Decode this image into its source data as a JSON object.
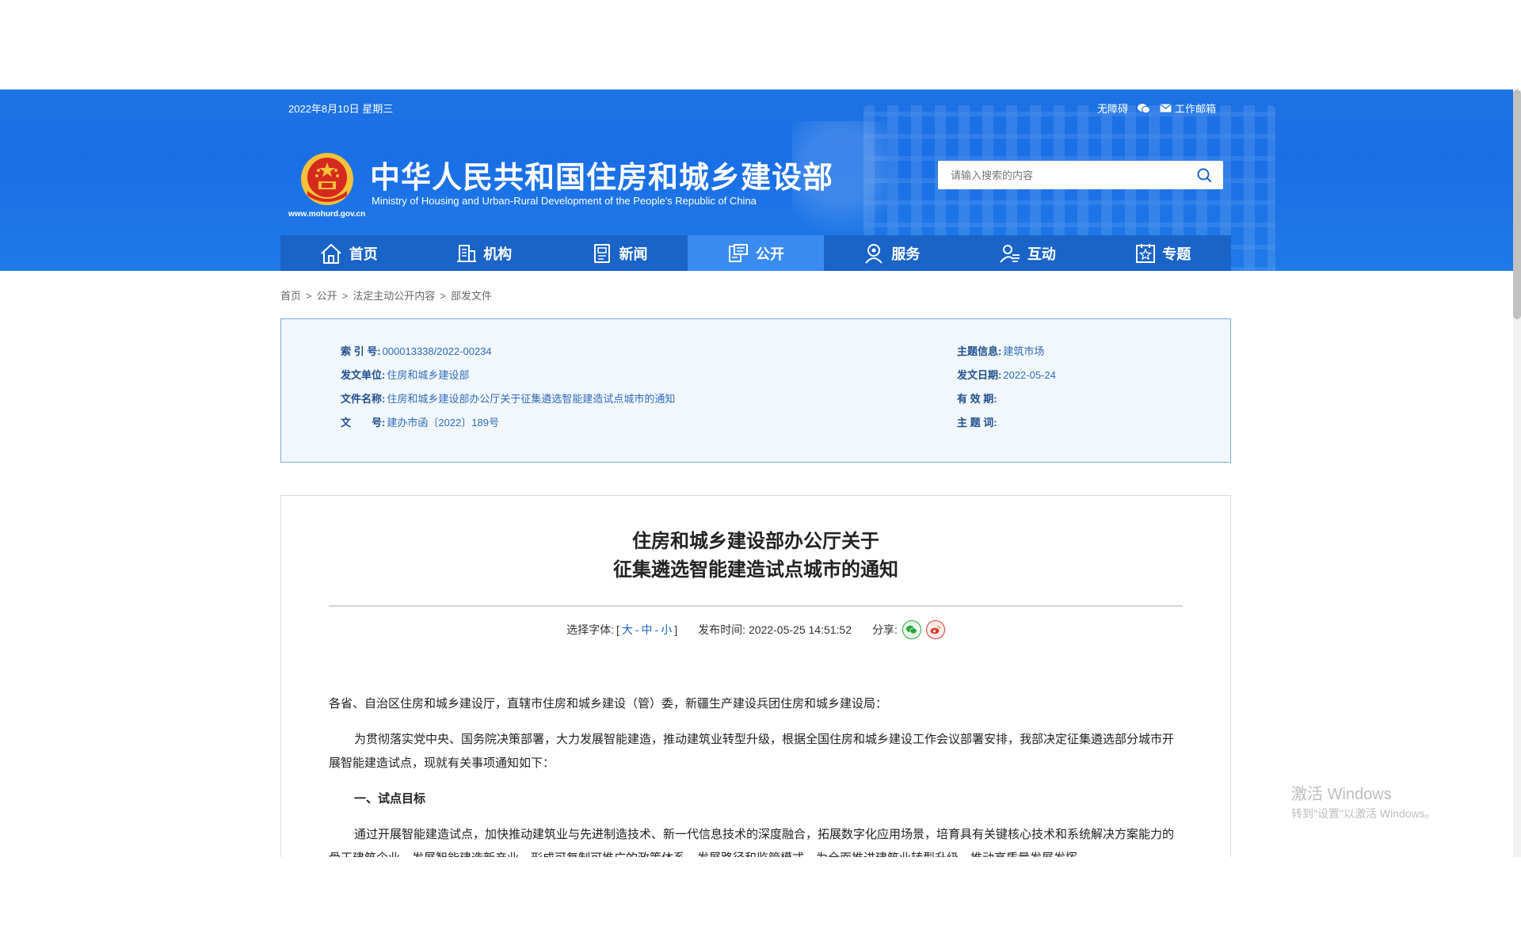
{
  "header": {
    "date": "2022年8月10日 星期三",
    "accessibility": "无障碍",
    "mail": "工作邮箱",
    "title": "中华人民共和国住房和城乡建设部",
    "subtitle": "Ministry of Housing and Urban-Rural Development of the People's Republic of China",
    "url": "www.mohurd.gov.cn",
    "search_placeholder": "请输入搜索的内容"
  },
  "nav": {
    "items": [
      {
        "label": "首页",
        "icon": "home-icon"
      },
      {
        "label": "机构",
        "icon": "building-icon"
      },
      {
        "label": "新闻",
        "icon": "news-icon"
      },
      {
        "label": "公开",
        "icon": "disclosure-icon"
      },
      {
        "label": "服务",
        "icon": "service-icon"
      },
      {
        "label": "互动",
        "icon": "interaction-icon"
      },
      {
        "label": "专题",
        "icon": "topic-icon"
      }
    ],
    "active": "公开"
  },
  "breadcrumb": [
    "首页",
    "公开",
    "法定主动公开内容",
    "部发文件"
  ],
  "info": {
    "index_label": "索 引 号:",
    "index_value": "000013338/2022-00234",
    "issuer_label": "发文单位:",
    "issuer_value": "住房和城乡建设部",
    "name_label": "文件名称:",
    "name_value": "住房和城乡建设部办公厅关于征集遴选智能建造试点城市的通知",
    "doc_label": "文　　号:",
    "doc_value": "建办市函〔2022〕189号",
    "topic_label": "主题信息:",
    "topic_value": "建筑市场",
    "date_label": "发文日期:",
    "date_value": "2022-05-24",
    "validity_label": "有 效 期:",
    "keywords_label": "主 题 词:"
  },
  "article": {
    "title_line1": "住房和城乡建设部办公厅关于",
    "title_line2": "征集遴选智能建造试点城市的通知",
    "font_label": "选择字体:",
    "font_open": "[",
    "font_large": "大",
    "font_mid": "中",
    "font_small": "小",
    "font_close": "]",
    "dash": "-",
    "publish_label": "发布时间:",
    "publish_time": "2022-05-25 14:51:52",
    "share_label": "分享:",
    "para1": "各省、自治区住房和城乡建设厅，直辖市住房和城乡建设（管）委，新疆生产建设兵团住房和城乡建设局：",
    "para2": "为贯彻落实党中央、国务院决策部署，大力发展智能建造，推动建筑业转型升级，根据全国住房和城乡建设工作会议部署安排，我部决定征集遴选部分城市开展智能建造试点，现就有关事项通知如下：",
    "heading1": "一、试点目标",
    "para3": "通过开展智能建造试点，加快推动建筑业与先进制造技术、新一代信息技术的深度融合，拓展数字化应用场景，培育具有关键核心技术和系统解决方案能力的骨干建筑企业，发展智能建造新产业，形成可复制可推广的政策体系、发展路径和监管模式，为全面推进建筑业转型升级、推动高质量发展发挥"
  },
  "watermark": {
    "line1": "激活 Windows",
    "line2": "转到\"设置\"以激活 Windows。"
  },
  "colors": {
    "header_blue": "#1a6fe6",
    "nav_blue": "#1a63c7",
    "nav_active": "#3a8bf0",
    "emblem_red": "#d62a1e",
    "emblem_gold": "#f3c13a"
  }
}
